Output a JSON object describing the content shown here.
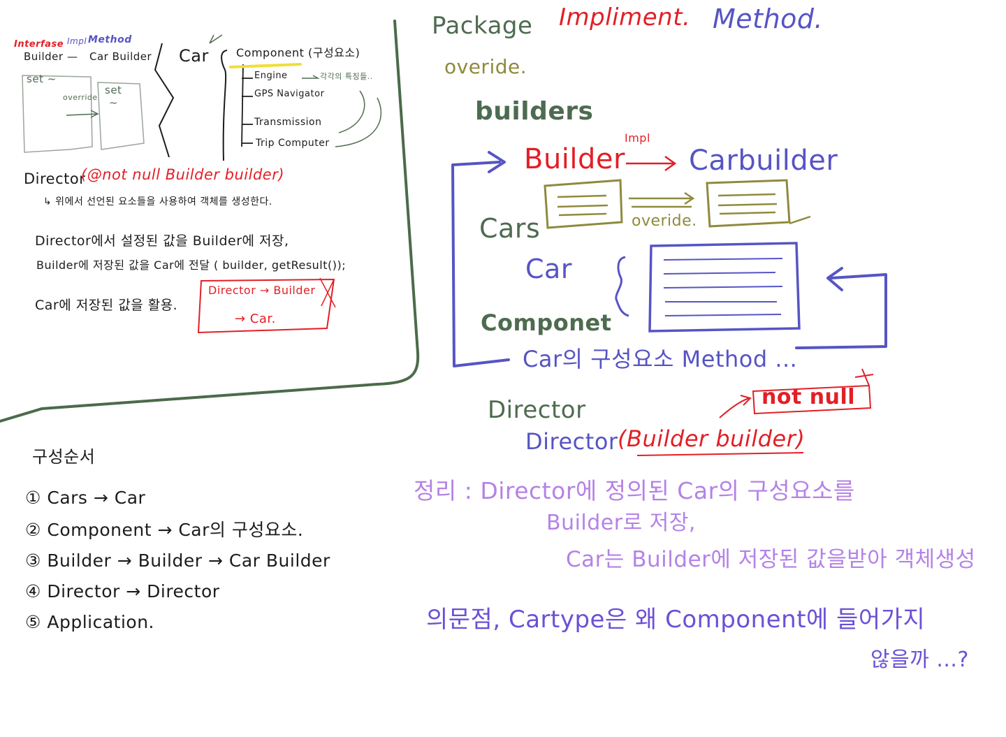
{
  "colors": {
    "black": "#1c1c1c",
    "green": "#4e6b50",
    "olive": "#8f8a3c",
    "red": "#e21f26",
    "blue": "#5654c4",
    "violet": "#b582e6",
    "purple": "#6c50d6",
    "frame": "#4b6b4a",
    "highlight": "#f0de3a"
  },
  "left_panel": {
    "header": {
      "interface": "Interfase",
      "impl": "Impl",
      "method": "Method"
    },
    "builder_row": {
      "builder": "Builder",
      "dash": "—",
      "car_builder": "Car Builder"
    },
    "car": "Car",
    "component": "Component (구성요소)",
    "parts": [
      "Engine",
      "GPS Navigator",
      "Transmission",
      "Trip Computer"
    ],
    "engine_note": "각각의 특징들..",
    "set_left": "set ~",
    "set_right": "set",
    "set_right_wave": "~",
    "override": "override",
    "director": {
      "prefix": "Director",
      "params": "(@not null Builder builder)"
    },
    "director_note": "↳ 위에서 선언된 요소들을 사용하여 객체를 생성한다.",
    "notes": [
      "Director에서 설정된 값을 Builder에 저장,",
      "Builder에 저장된 값을 Car에 전달 ( builder, getResult());",
      "Car에 저장된 값을 활용."
    ],
    "flow_box": {
      "line1": "Director → Builder",
      "line2": "→ Car."
    }
  },
  "order": {
    "title": "구성순서",
    "items": [
      "① Cars → Car",
      "② Component → Car의 구성요소.",
      "③ Builder → Builder → Car Builder",
      "④ Director → Director",
      "⑤ Application."
    ]
  },
  "right_panel": {
    "title": {
      "package": "Package",
      "impl": "Impliment.",
      "method": "Method."
    },
    "override_top": "overide.",
    "builders": "builders",
    "builder": "Builder",
    "impl_label": "Impl",
    "carbuilder": "Carbuilder",
    "cars": "Cars",
    "override_mid": "overide.",
    "car": "Car",
    "componet": "Componet",
    "car_methods": "Car의 구성요소 Method ...",
    "director_pkg": "Director",
    "director_call_prefix": "Director",
    "director_call_args": "(Builder builder)",
    "not_null": "not null",
    "summary": [
      "정리 : Director에 정의된 Car의 구성요소를",
      "Builder로 저장,",
      "Car는 Builder에 저장된 값을받아 객체생성"
    ],
    "question": [
      "의문점, Cartype은 왜 Component에 들어가지",
      "않을까 ...?"
    ]
  }
}
